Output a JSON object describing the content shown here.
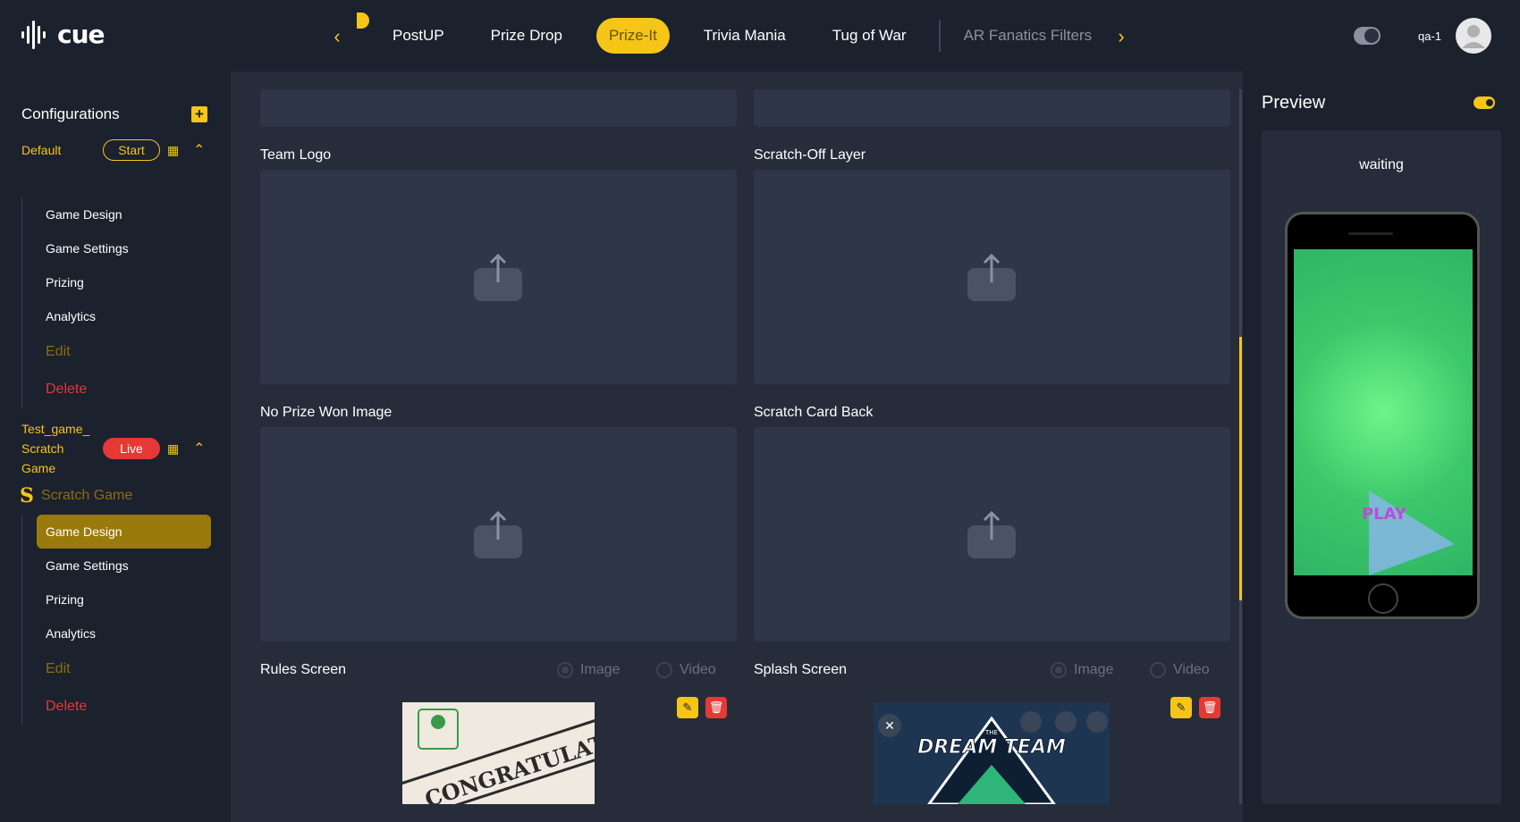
{
  "app": {
    "logo": "cue"
  },
  "nav": {
    "tabs": [
      {
        "label": "PostUP"
      },
      {
        "label": "Prize Drop"
      },
      {
        "label": "Prize-It"
      },
      {
        "label": "Trivia Mania"
      },
      {
        "label": "Tug of War"
      },
      {
        "label": "AR Fanatics Filters"
      }
    ],
    "active_tab": "Prize-It"
  },
  "user": {
    "name": "qa-1"
  },
  "sidebar": {
    "title": "Configurations",
    "configs": [
      {
        "name": "Default",
        "status": "Start",
        "menu": [
          "Game Design",
          "Game Settings",
          "Prizing",
          "Analytics",
          "Edit",
          "Delete"
        ]
      },
      {
        "name_line1": "Test_game_",
        "name_line2": "Scratch",
        "name_line3": "Game",
        "status": "Live",
        "game_type": "Scratch Game",
        "menu": [
          "Game Design",
          "Game Settings",
          "Prizing",
          "Analytics",
          "Edit",
          "Delete"
        ],
        "active_item": "Game Design"
      }
    ]
  },
  "main": {
    "fields": {
      "team_logo": "Team Logo",
      "scratch_off_layer": "Scratch-Off Layer",
      "no_prize_won_image": "No Prize Won Image",
      "scratch_card_back": "Scratch Card Back",
      "rules_screen": "Rules Screen",
      "splash_screen": "Splash Screen"
    },
    "media_options": {
      "image": "Image",
      "video": "Video"
    },
    "rules_image_text": "CONGRATULATIONS!",
    "splash_image_text": "DREAM TEAM",
    "splash_image_small": "THE"
  },
  "preview": {
    "title": "Preview",
    "status": "waiting",
    "play_label": "PLAY"
  },
  "colors": {
    "accent": "#f5c518",
    "danger": "#e53935",
    "bg": "#1c212e",
    "panel": "#2e3647"
  }
}
